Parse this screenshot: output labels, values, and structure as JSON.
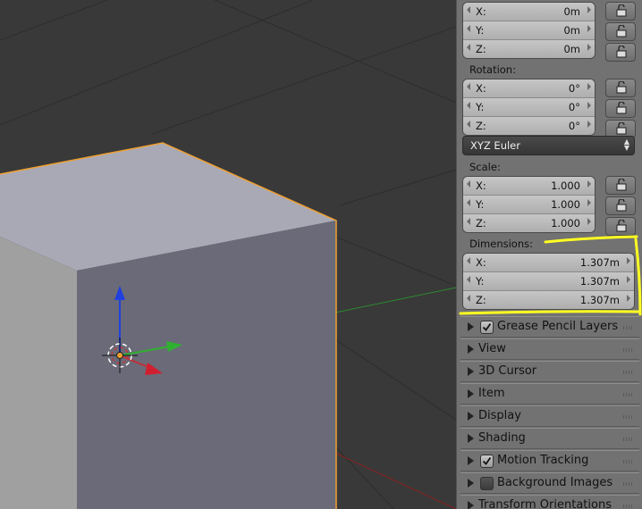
{
  "location": {
    "fields": [
      {
        "label": "X:",
        "value": "0m"
      },
      {
        "label": "Y:",
        "value": "0m"
      },
      {
        "label": "Z:",
        "value": "0m"
      }
    ]
  },
  "rotation": {
    "label": "Rotation:",
    "fields": [
      {
        "label": "X:",
        "value": "0°"
      },
      {
        "label": "Y:",
        "value": "0°"
      },
      {
        "label": "Z:",
        "value": "0°"
      }
    ],
    "mode": "XYZ Euler"
  },
  "scale": {
    "label": "Scale:",
    "fields": [
      {
        "label": "X:",
        "value": "1.000"
      },
      {
        "label": "Y:",
        "value": "1.000"
      },
      {
        "label": "Z:",
        "value": "1.000"
      }
    ]
  },
  "dimensions": {
    "label": "Dimensions:",
    "fields": [
      {
        "label": "X:",
        "value": "1.307m"
      },
      {
        "label": "Y:",
        "value": "1.307m"
      },
      {
        "label": "Z:",
        "value": "1.307m"
      }
    ]
  },
  "sections": [
    {
      "title": "Grease Pencil Layers",
      "checkbox": true,
      "checked": true
    },
    {
      "title": "View",
      "checkbox": false
    },
    {
      "title": "3D Cursor",
      "checkbox": false
    },
    {
      "title": "Item",
      "checkbox": false
    },
    {
      "title": "Display",
      "checkbox": false
    },
    {
      "title": "Shading",
      "checkbox": false
    },
    {
      "title": "Motion Tracking",
      "checkbox": true,
      "checked": true
    },
    {
      "title": "Background Images",
      "checkbox": true,
      "checked": false
    },
    {
      "title": "Transform Orientations",
      "checkbox": false
    }
  ],
  "colors": {
    "viewport_bg": "#393939",
    "panel_bg": "#727272",
    "cube_top": "#a9a9b6",
    "cube_front": "#6a6a78",
    "cube_left": "#a0a0a0",
    "selection_outline": "#f0a030",
    "highlight": "#ffff22",
    "axis_x": "#c0303a",
    "axis_y": "#30b030",
    "axis_z": "#2040e0"
  }
}
